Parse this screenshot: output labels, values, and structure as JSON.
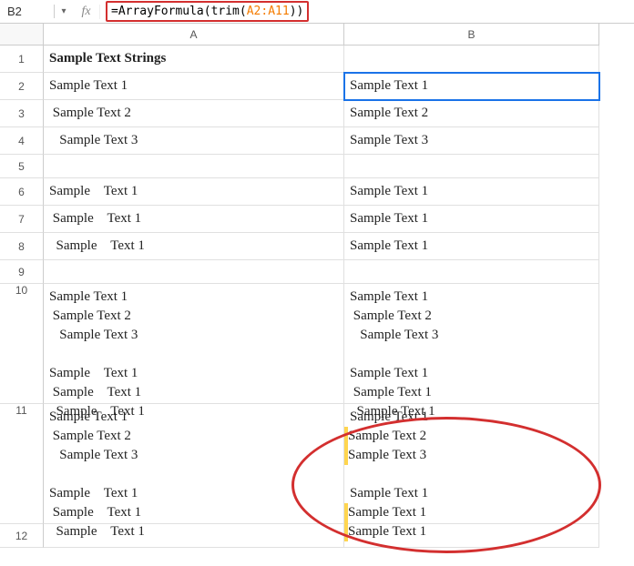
{
  "formulaBar": {
    "cellRef": "B2",
    "fx": "fx",
    "formulaPrefix": "=ArrayFormula(trim(",
    "formulaRange": "A2:A11",
    "formulaSuffix": "))"
  },
  "columns": {
    "a": "A",
    "b": "B"
  },
  "rows": {
    "r1": {
      "num": "1",
      "a": "Sample Text Strings",
      "b": ""
    },
    "r2": {
      "num": "2",
      "a": "Sample Text 1",
      "b": "Sample Text 1"
    },
    "r3": {
      "num": "3",
      "a": " Sample Text 2",
      "b": "Sample Text 2"
    },
    "r4": {
      "num": "4",
      "a": "   Sample Text 3",
      "b": "Sample Text 3"
    },
    "r5": {
      "num": "5",
      "a": "",
      "b": ""
    },
    "r6": {
      "num": "6",
      "a": "Sample    Text 1",
      "b": "Sample Text 1"
    },
    "r7": {
      "num": "7",
      "a": " Sample    Text 1",
      "b": "Sample Text 1"
    },
    "r8": {
      "num": "8",
      "a": "  Sample    Text 1",
      "b": "Sample Text 1"
    },
    "r9": {
      "num": "9",
      "a": "",
      "b": ""
    },
    "r10": {
      "num": "10",
      "a": "Sample Text 1\n Sample Text 2\n   Sample Text 3\n\nSample    Text 1\n Sample    Text 1\n  Sample    Text 1",
      "b": "Sample Text 1\n Sample Text 2\n   Sample Text 3\n\nSample Text 1\n Sample Text 1\n  Sample Text 1"
    },
    "r11": {
      "num": "11",
      "a": "Sample Text 1\n Sample Text 2\n   Sample Text 3\n\nSample    Text 1\n Sample    Text 1\n  Sample    Text 1",
      "b_lines": [
        {
          "bar": false,
          "text": "Sample Text 1"
        },
        {
          "bar": true,
          "text": "Sample Text 2"
        },
        {
          "bar": true,
          "text": "Sample Text 3"
        },
        {
          "bar": false,
          "text": ""
        },
        {
          "bar": false,
          "text": "Sample Text 1"
        },
        {
          "bar": true,
          "text": "Sample Text 1"
        },
        {
          "bar": true,
          "text": "Sample Text 1"
        }
      ]
    },
    "r12": {
      "num": "12",
      "a": "",
      "b": ""
    }
  }
}
